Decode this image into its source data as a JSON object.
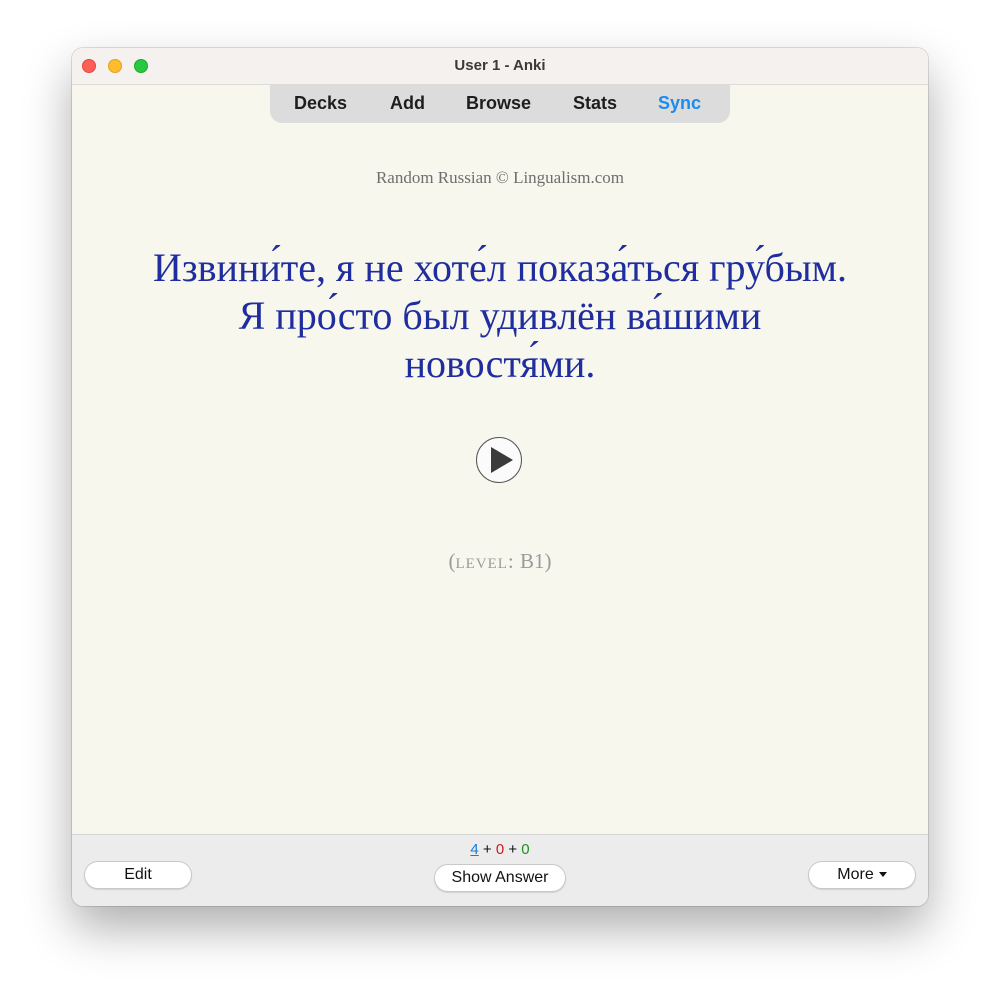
{
  "window": {
    "title": "User 1 - Anki"
  },
  "toolbar": {
    "decks": "Decks",
    "add": "Add",
    "browse": "Browse",
    "stats": "Stats",
    "sync": "Sync",
    "sync_color": "#1a8cf0"
  },
  "card": {
    "source": "Random Russian © Lingualism.com",
    "sentence_line1": "Извини́те, я не хоте́л показа́ться гру́бым.",
    "sentence_line2": "Я про́сто был удивлён ва́шими",
    "sentence_line3": "новостя́ми.",
    "sentence_color": "#1f2d9e",
    "audio_icon": "play-icon",
    "level_open": "(",
    "level_word": "level:",
    "level_value": " B1)"
  },
  "bottom": {
    "edit_label": "Edit",
    "show_answer_label": "Show Answer",
    "more_label": "More",
    "counts": {
      "new": "4",
      "sep1": " + ",
      "learn": "0",
      "sep2": " + ",
      "review": "0"
    },
    "colors": {
      "new": "#1a7bd6",
      "learn": "#cc1a1a",
      "review": "#1f8f1f"
    }
  }
}
